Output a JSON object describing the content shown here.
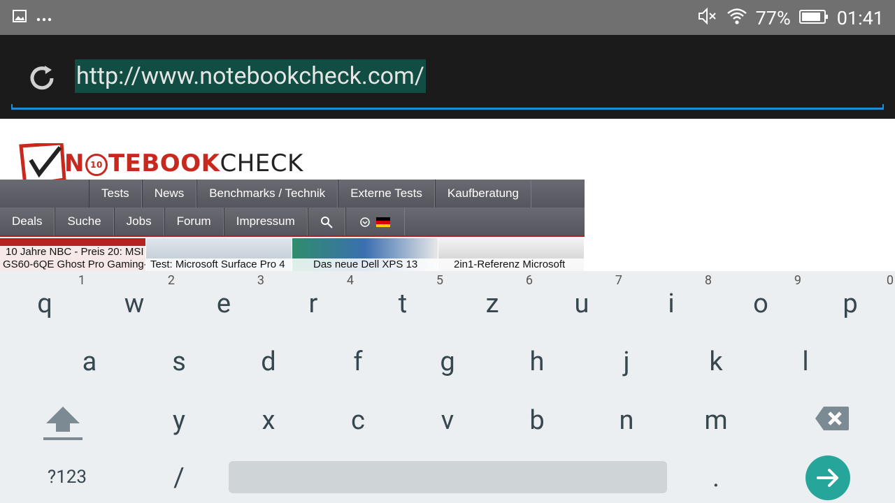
{
  "status_bar": {
    "left_icons": [
      "image-icon",
      "more-dots-icon"
    ],
    "battery_percent": "77%",
    "time": "01:41",
    "right_icons": [
      "mute-icon",
      "wifi-icon",
      "battery-icon"
    ]
  },
  "url_bar": {
    "url": "http://www.notebookcheck.com/",
    "reload_icon": "reload-icon",
    "accent_color": "#1a8fd8",
    "selection_color": "#114d43"
  },
  "page": {
    "logo_text_a": "N",
    "logo_text_b": "TEBOOK",
    "logo_text_c": "CHECK",
    "logo_badge": "10",
    "nav_primary": [
      "Tests",
      "News",
      "Benchmarks / Technik",
      "Externe Tests",
      "Kaufberatung"
    ],
    "nav_secondary": [
      "Deals",
      "Suche",
      "Jobs",
      "Forum",
      "Impressum"
    ],
    "thumbnails": [
      {
        "line1": "10 Jahre NBC - Preis 20: MSI",
        "line2": "GS60-6QE Ghost Pro Gaming-"
      },
      {
        "line1": "",
        "line2": "Test: Microsoft Surface Pro 4"
      },
      {
        "line1": "",
        "line2": "Das neue Dell XPS 13"
      },
      {
        "line1": "",
        "line2": "2in1-Referenz Microsoft"
      }
    ]
  },
  "keyboard": {
    "row1": [
      {
        "k": "q",
        "h": "1"
      },
      {
        "k": "w",
        "h": "2"
      },
      {
        "k": "e",
        "h": "3"
      },
      {
        "k": "r",
        "h": "4"
      },
      {
        "k": "t",
        "h": "5"
      },
      {
        "k": "z",
        "h": "6"
      },
      {
        "k": "u",
        "h": "7"
      },
      {
        "k": "i",
        "h": "8"
      },
      {
        "k": "o",
        "h": "9"
      },
      {
        "k": "p",
        "h": "0"
      }
    ],
    "row2": [
      "a",
      "s",
      "d",
      "f",
      "g",
      "h",
      "j",
      "k",
      "l"
    ],
    "row3": [
      "y",
      "x",
      "c",
      "v",
      "b",
      "n",
      "m"
    ],
    "symbols_label": "?123",
    "slash": "/",
    "period": ".",
    "enter_color": "#26a69a"
  }
}
